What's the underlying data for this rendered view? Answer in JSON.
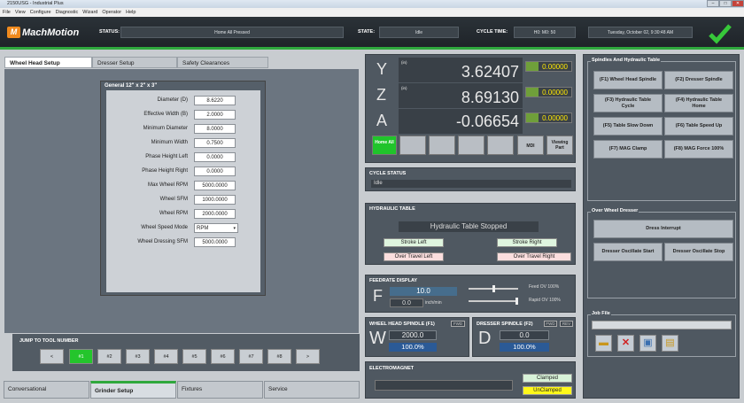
{
  "window": {
    "title": "2150USG - Industrial Plus",
    "controls": [
      "–",
      "□",
      "✕"
    ]
  },
  "menu": [
    "File",
    "View",
    "Configure",
    "Diagnostic",
    "Wizard",
    "Operator",
    "Help"
  ],
  "header": {
    "logo": "MachMotion",
    "status_label": "STATUS:",
    "status_value": "Home All Pressed",
    "state_label": "STATE:",
    "state_value": "Idle",
    "cycle_label": "CYCLE TIME:",
    "cycle_value": "H0: M0: 50",
    "datetime": "Tuesday, October 02, 9:30:48 AM",
    "accent": "#2fa83d"
  },
  "left_tabs": [
    "Wheel Head Setup",
    "Dresser Setup",
    "Safety Clearances"
  ],
  "general": {
    "title": "General 12\" x 2\" x 3\"",
    "fields": [
      {
        "label": "Diameter (D)",
        "value": "8.6220"
      },
      {
        "label": "Effective Width (B)",
        "value": "2.0000"
      },
      {
        "label": "Minimum Diameter",
        "value": "8.0000"
      },
      {
        "label": "Minimum Width",
        "value": "0.7500"
      },
      {
        "label": "Phase Height Left",
        "value": "0.0000"
      },
      {
        "label": "Phase Height Right",
        "value": "0.0000"
      },
      {
        "label": "Max Wheel RPM",
        "value": "5000.0000"
      },
      {
        "label": "Wheel SFM",
        "value": "1000.0000"
      },
      {
        "label": "Wheel RPM",
        "value": "2000.0000"
      },
      {
        "label": "Wheel Speed Mode",
        "value": "RPM"
      },
      {
        "label": "Wheel Dressing SFM",
        "value": "5000.0000"
      }
    ]
  },
  "jump": {
    "title": "JUMP TO TOOL NUMBER",
    "buttons": [
      "<",
      "#1",
      "#2",
      "#3",
      "#4",
      "#5",
      "#6",
      "#7",
      "#8",
      ">"
    ],
    "active": "#1"
  },
  "bottom_tabs": [
    "Conversational",
    "Grinder Setup",
    "Fixtures",
    "Service"
  ],
  "dro": {
    "axes": [
      {
        "axis": "Y",
        "unit": "(in)",
        "value": "3.62407",
        "offset": "0.00000"
      },
      {
        "axis": "Z",
        "unit": "(in)",
        "value": "8.69130",
        "offset": "0.00000"
      },
      {
        "axis": "A",
        "unit": "",
        "value": "-0.06654",
        "offset": "0.00000"
      }
    ],
    "home_all": "Home All",
    "mdi": "MDI",
    "viewing_part": "Viewing Part"
  },
  "cycle_status": {
    "title": "CYCLE STATUS",
    "value": "Idle"
  },
  "hydraulic": {
    "title": "HYDRAULIC TABLE",
    "status": "Hydraulic Table Stopped",
    "stroke_left": "Stroke Left",
    "stroke_right": "Stroke Right",
    "over_left": "Over Travel Left",
    "over_right": "Over Travel Right"
  },
  "feedrate": {
    "title": "FEEDRATE DISPLAY",
    "letter": "F",
    "override": "10.0",
    "actual": "0.0",
    "unit": "inch/min",
    "feed_ov": "Feed OV 100%",
    "rapid_ov": "Rapid OV 100%",
    "feed_ov_level": 0.5,
    "rapid_ov_level": 1.0
  },
  "wheel_spindle": {
    "title": "WHEEL HEAD SPINDLE (F1)",
    "tag": "FWD",
    "letter": "W",
    "rpm": "2000.0",
    "pct": "100.0%"
  },
  "dresser_spindle": {
    "title": "DRESSER SPINDLE (F2)",
    "tag_fwd": "FWD",
    "tag_rev": "REV",
    "letter": "D",
    "rpm": "0.0",
    "pct": "100.0%"
  },
  "electromagnet": {
    "title": "ELECTROMAGNET",
    "clamped": "Clamped",
    "unclamped": "UnClamped"
  },
  "spindles_group": {
    "title": "Spindles And Hydraulic Table",
    "buttons": [
      "(F1) Wheel Head Spindle",
      "(F2) Dresser Spindle",
      "(F3) Hydraulic Table Cycle",
      "(F4) Hydraulic Table Home",
      "(F5) Table Slow Down",
      "(F6) Table Speed Up",
      "(F7) MAG Clamp",
      "(F8) MAG Force 100%"
    ]
  },
  "dresser_group": {
    "title": "Over Wheel Dresser",
    "interrupt": "Dress Interrupt",
    "osc_start": "Dresser Oscillate Start",
    "osc_stop": "Dresser Oscillate Stop"
  },
  "job_file": {
    "title": "Job File",
    "icons": [
      "folder-icon",
      "delete-icon",
      "save-icon",
      "load-icon"
    ]
  }
}
